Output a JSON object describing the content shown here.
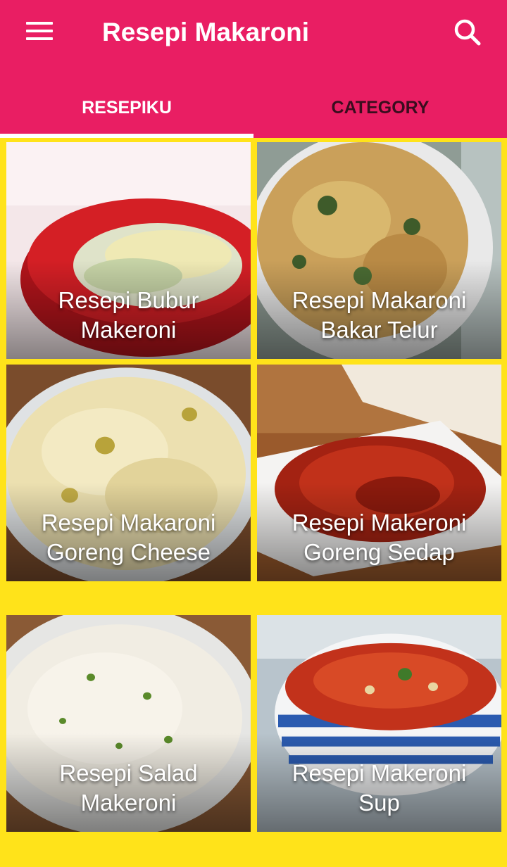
{
  "app": {
    "title": "Resepi Makaroni",
    "menu_icon": "menu-icon",
    "search_icon": "search-icon",
    "primary_color": "#e91e63",
    "grid_background": "#ffe31a"
  },
  "tabs": [
    {
      "label": "RESEPIKU",
      "active": true
    },
    {
      "label": "CATEGORY",
      "active": false
    }
  ],
  "recipes": [
    {
      "line1": "Resepi Bubur",
      "line2": "Makeroni"
    },
    {
      "line1": "Resepi Makaroni",
      "line2": "Bakar Telur"
    },
    {
      "line1": "Resepi Makaroni",
      "line2": "Goreng Cheese"
    },
    {
      "line1": "Resepi Makeroni",
      "line2": "Goreng Sedap"
    },
    {
      "line1": "Resepi Salad",
      "line2": "Makeroni"
    },
    {
      "line1": "Resepi Makeroni",
      "line2": "Sup"
    }
  ]
}
